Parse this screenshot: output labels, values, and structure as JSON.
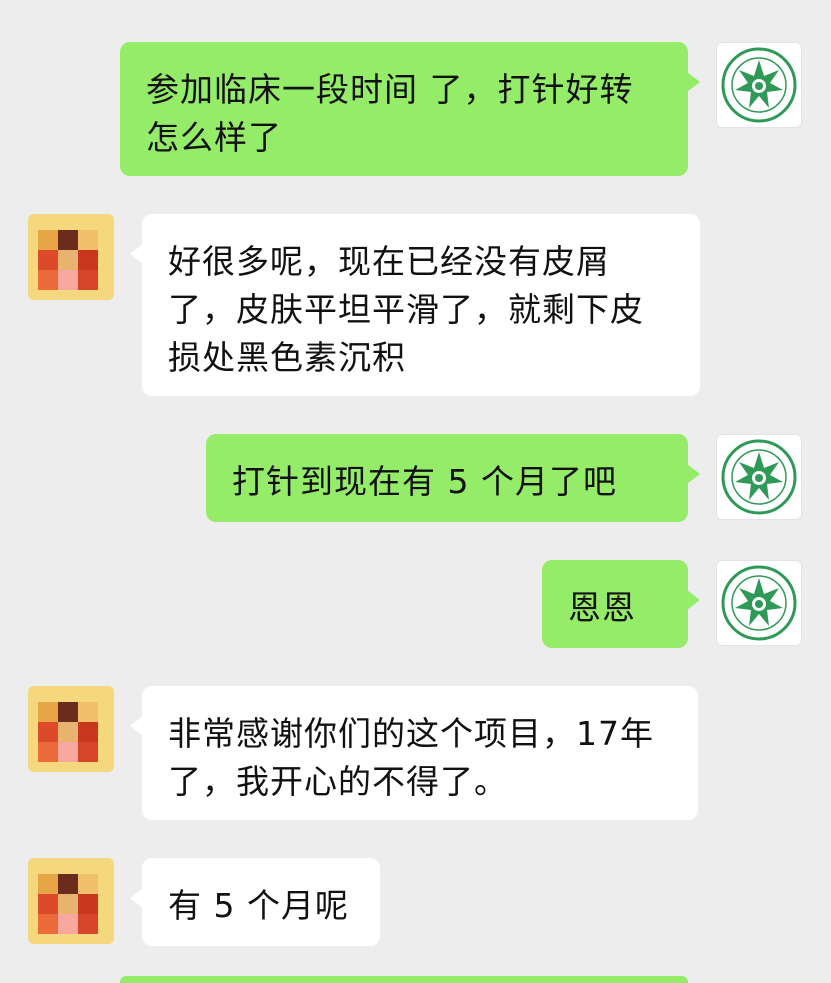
{
  "colors": {
    "background": "#ededed",
    "self_bubble": "#95ec69",
    "other_bubble": "#ffffff",
    "seal_green": "#2f9a58",
    "text": "#111111"
  },
  "avatars": {
    "self_icon": "green-seal-logo-icon",
    "other_icon": "pixelated-avatar-icon"
  },
  "messages": [
    {
      "sender": "self",
      "text": "参加临床一段时间 了，打针好转怎么样了"
    },
    {
      "sender": "other",
      "text": "好很多呢，现在已经没有皮屑了，皮肤平坦平滑了，就剩下皮损处黑色素沉积"
    },
    {
      "sender": "self",
      "text": "打针到现在有 5 个月了吧"
    },
    {
      "sender": "self",
      "text": "恩恩"
    },
    {
      "sender": "other",
      "text": "非常感谢你们的这个项目，17年了，我开心的不得了。"
    },
    {
      "sender": "other",
      "text": "有 5 个月呢"
    }
  ]
}
